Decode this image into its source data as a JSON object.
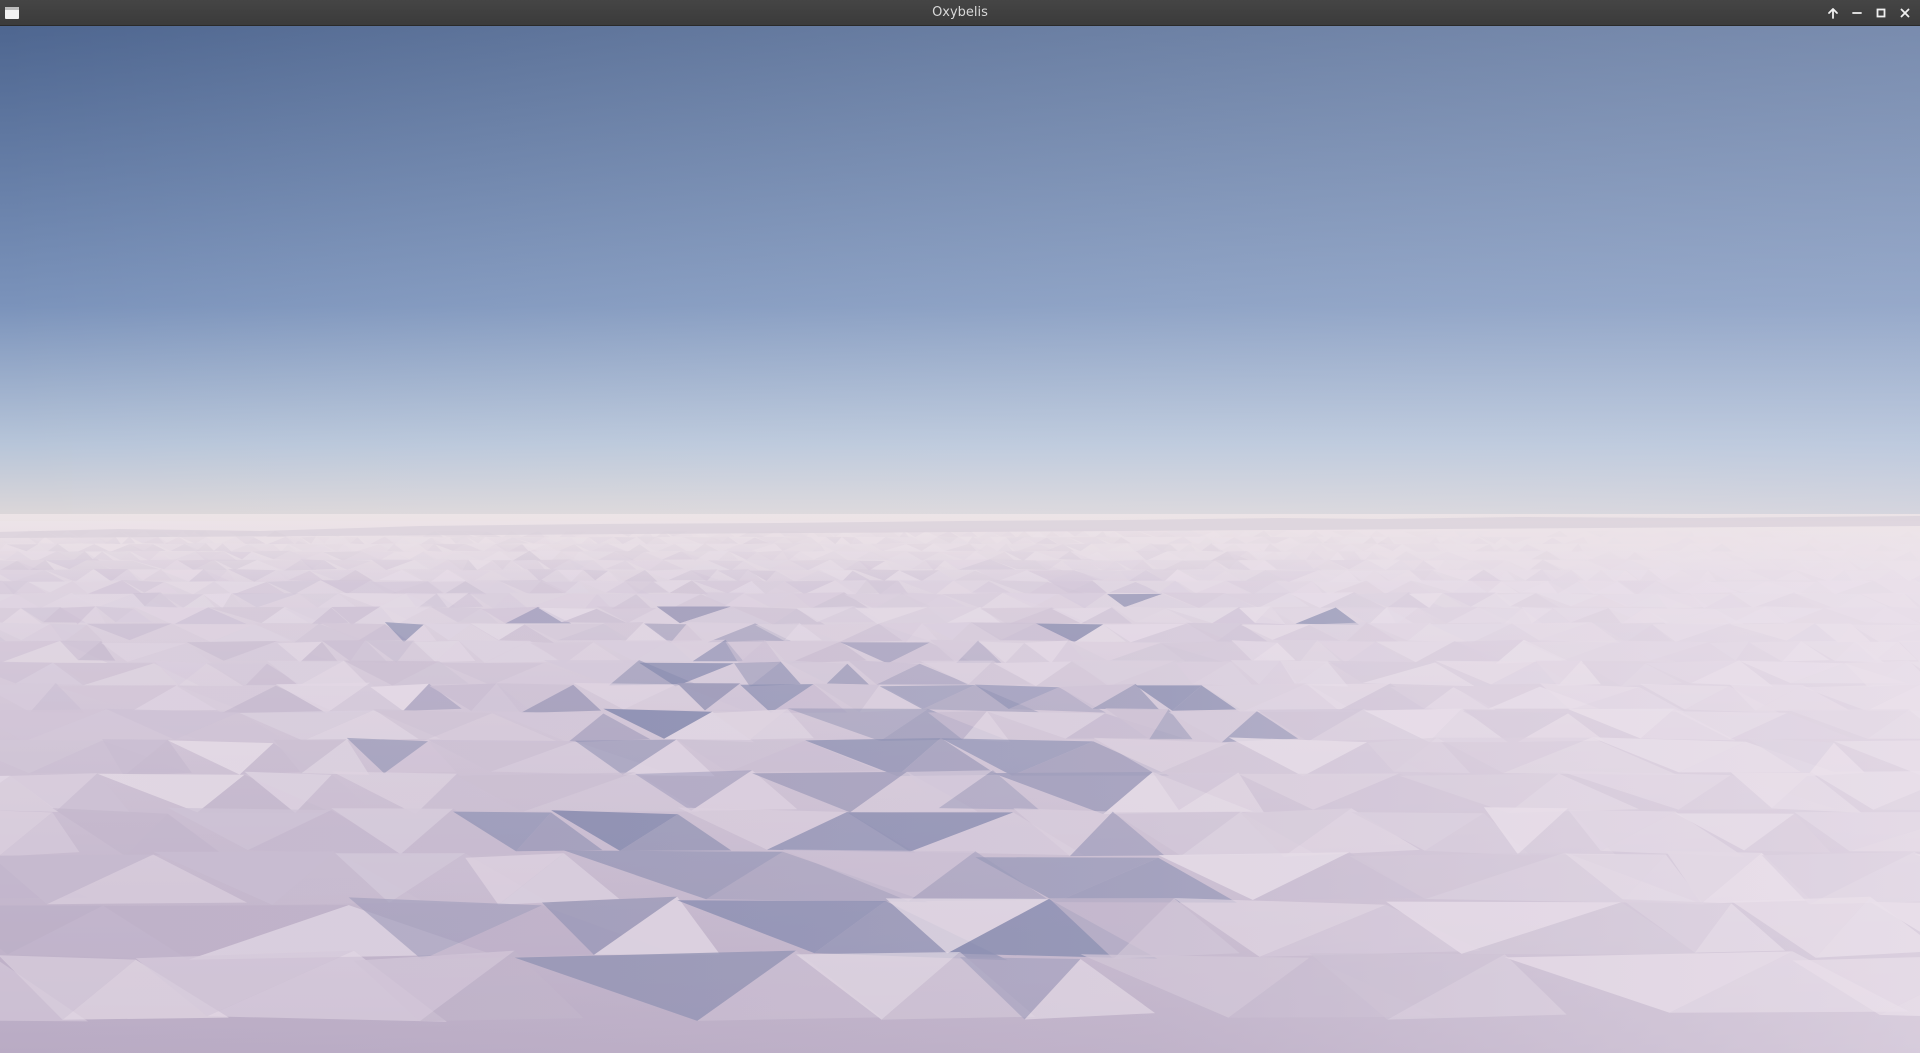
{
  "window": {
    "title": "Oxybelis",
    "icons": {
      "app": "app-window-icon",
      "keep_above": "arrow-up-icon",
      "minimize": "minimize-icon",
      "maximize": "maximize-icon",
      "close": "close-icon"
    }
  },
  "scene": {
    "type": "low-poly snow terrain under clear sky",
    "colors": {
      "sky_top": "#4e6690",
      "sky_mid": "#7b93bb",
      "horizon_glow": "#e7dcd9",
      "snow_light": "#e6dce7",
      "snow_mid": "#bdb0c8",
      "snow_shadow": "#6f7aa3"
    }
  }
}
